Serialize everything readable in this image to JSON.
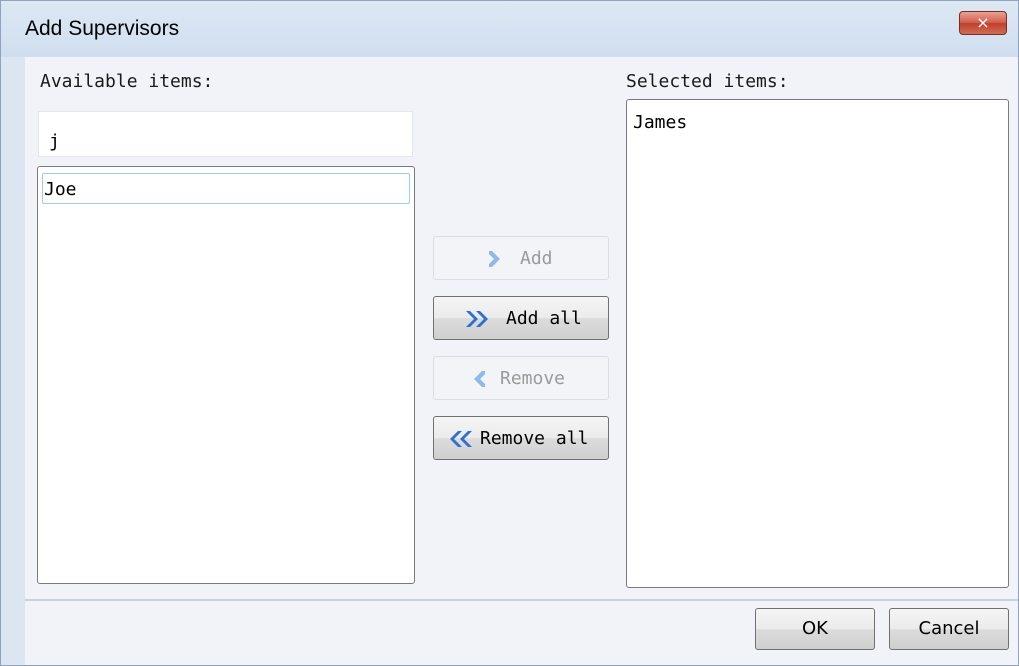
{
  "window": {
    "title": "Add Supervisors",
    "close_glyph": "×"
  },
  "available": {
    "label": "Available items:",
    "filter_value": "j",
    "items": [
      "Joe"
    ]
  },
  "selected": {
    "label": "Selected items:",
    "items": [
      "James"
    ]
  },
  "transfer_buttons": {
    "add": "Add",
    "add_all": "Add all",
    "remove": "Remove",
    "remove_all": "Remove all"
  },
  "dialog_buttons": {
    "ok": "OK",
    "cancel": "Cancel"
  },
  "icons": {
    "add": "chevron-right-icon",
    "add_all": "double-chevron-right-icon",
    "remove": "chevron-left-icon",
    "remove_all": "double-chevron-left-icon",
    "close": "close-icon"
  },
  "colors": {
    "accent_blue": "#2f6fd1",
    "disabled_blue": "#90b8ea",
    "close_red": "#c94a35",
    "title_bg": "#d6e3f1"
  }
}
